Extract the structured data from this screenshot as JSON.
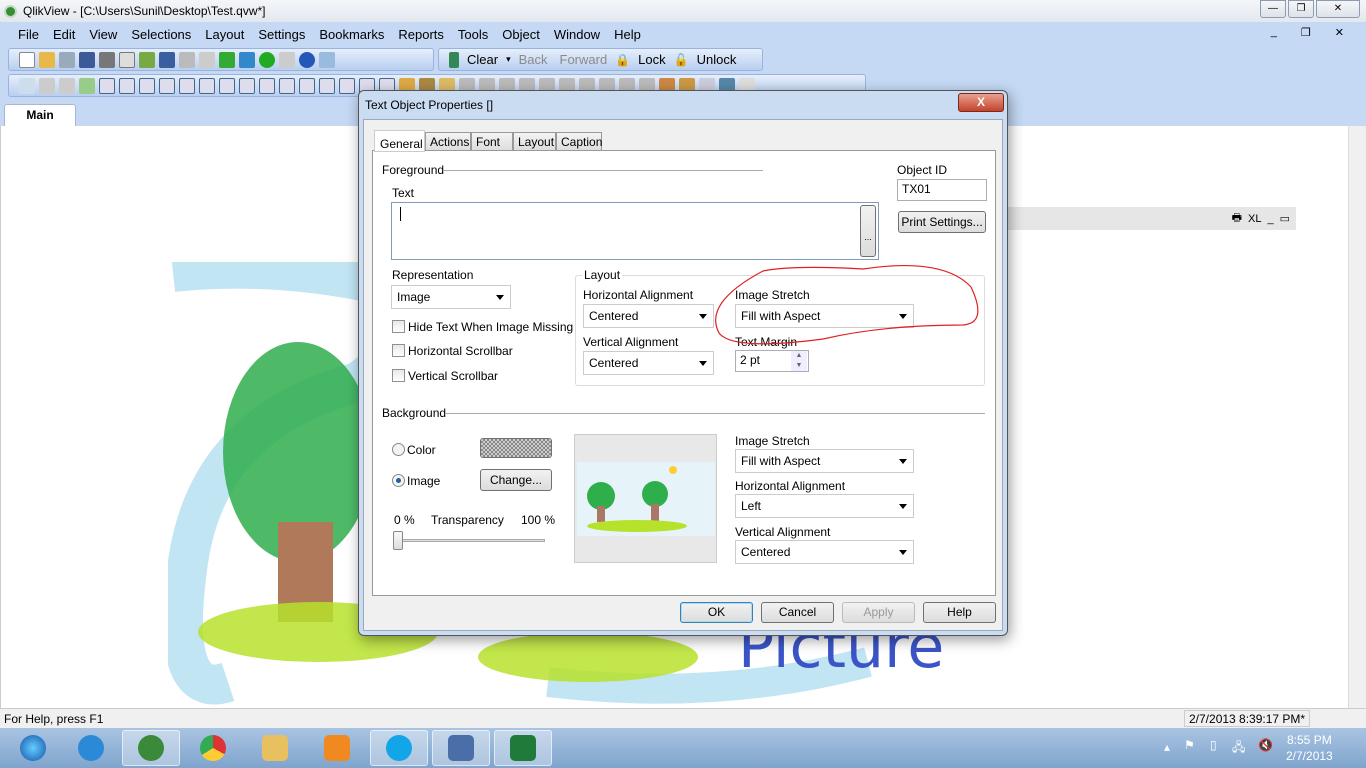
{
  "window": {
    "title": "QlikView - [C:\\Users\\Sunil\\Desktop\\Test.qvw*]"
  },
  "menu": [
    "File",
    "Edit",
    "View",
    "Selections",
    "Layout",
    "Settings",
    "Bookmarks",
    "Reports",
    "Tools",
    "Object",
    "Window",
    "Help"
  ],
  "toolbar": {
    "clear": "Clear",
    "back": "Back",
    "forward": "Forward",
    "lock": "Lock",
    "unlock": "Unlock"
  },
  "sheet_tab": "Main",
  "object_caption": {
    "xl": "XL"
  },
  "status": {
    "help": "For Help, press F1",
    "timestamp": "2/7/2013 8:39:17 PM*"
  },
  "clock": {
    "time": "8:55 PM",
    "date": "2/7/2013"
  },
  "dialog": {
    "title": "Text Object Properties []",
    "close": "X",
    "tabs": [
      "General",
      "Actions",
      "Font",
      "Layout",
      "Caption"
    ],
    "foreground_label": "Foreground",
    "text_label": "Text",
    "text_value": "",
    "ellipsis": "...",
    "object_id_label": "Object ID",
    "object_id": "TX01",
    "print_settings": "Print Settings...",
    "representation_label": "Representation",
    "representation": "Image",
    "hide_text": "Hide Text When Image Missing",
    "h_scrollbar": "Horizontal Scrollbar",
    "v_scrollbar": "Vertical Scrollbar",
    "layout_label": "Layout",
    "fg_halign_label": "Horizontal Alignment",
    "fg_halign": "Centered",
    "fg_valign_label": "Vertical Alignment",
    "fg_valign": "Centered",
    "fg_stretch_label": "Image Stretch",
    "fg_stretch": "Fill with Aspect",
    "text_margin_label": "Text Margin",
    "text_margin": "2 pt",
    "background_label": "Background",
    "color_label": "Color",
    "image_label": "Image",
    "change": "Change...",
    "transparency_min": "0 %",
    "transparency_label": "Transparency",
    "transparency_max": "100 %",
    "transparency_value": 0,
    "bg_stretch_label": "Image Stretch",
    "bg_stretch": "Fill with Aspect",
    "bg_halign_label": "Horizontal Alignment",
    "bg_halign": "Left",
    "bg_valign_label": "Vertical Alignment",
    "bg_valign": "Centered",
    "ok": "OK",
    "cancel": "Cancel",
    "apply": "Apply",
    "help": "Help"
  }
}
